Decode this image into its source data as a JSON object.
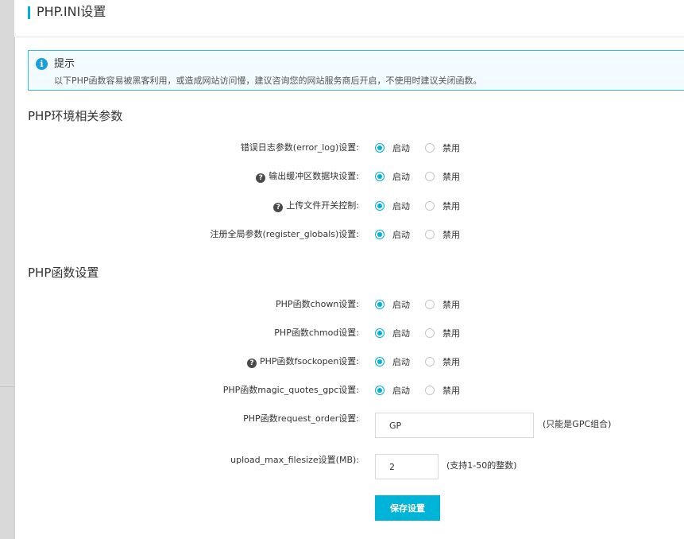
{
  "page_title": "PHP.INI设置",
  "tip": {
    "icon": "info-icon",
    "title": "提示",
    "text": "以下PHP函数容易被黑客利用，或造成网站访问慢，建议咨询您的网站服务商后开启，不使用时建议关闭函数。"
  },
  "colors": {
    "accent": "#00b0d8",
    "tip_border": "#37bfe3",
    "tip_bg": "#f2fbff"
  },
  "sections": [
    {
      "title": "PHP环境相关参数",
      "rows": [
        {
          "label": "错误日志参数(error_log)设置:",
          "help": false,
          "enable_label": "启动",
          "disable_label": "禁用",
          "selected": "启动"
        },
        {
          "label": "输出缓冲区数据块设置:",
          "help": true,
          "enable_label": "启动",
          "disable_label": "禁用",
          "selected": "启动"
        },
        {
          "label": "上传文件开关控制:",
          "help": true,
          "enable_label": "启动",
          "disable_label": "禁用",
          "selected": "启动"
        },
        {
          "label": "注册全局参数(register_globals)设置:",
          "help": false,
          "enable_label": "启动",
          "disable_label": "禁用",
          "selected": "启动"
        }
      ]
    },
    {
      "title": "PHP函数设置",
      "rows": [
        {
          "label": "PHP函数chown设置:",
          "help": false,
          "enable_label": "启动",
          "disable_label": "禁用",
          "selected": "启动"
        },
        {
          "label": "PHP函数chmod设置:",
          "help": false,
          "enable_label": "启动",
          "disable_label": "禁用",
          "selected": "启动"
        },
        {
          "label": "PHP函数fsockopen设置:",
          "help": true,
          "enable_label": "启动",
          "disable_label": "禁用",
          "selected": "启动"
        },
        {
          "label": "PHP函数magic_quotes_gpc设置:",
          "help": false,
          "enable_label": "启动",
          "disable_label": "禁用",
          "selected": "启动"
        }
      ],
      "fields": {
        "request_order": {
          "label": "PHP函数request_order设置:",
          "value": "GP",
          "hint": "(只能是GPC组合)"
        },
        "upload_max_filesize": {
          "label": "upload_max_filesize设置(MB):",
          "value": "2",
          "hint": "(支持1-50的整数)"
        }
      }
    }
  ],
  "help_icon": "question-circle-icon",
  "save_label": "保存设置"
}
